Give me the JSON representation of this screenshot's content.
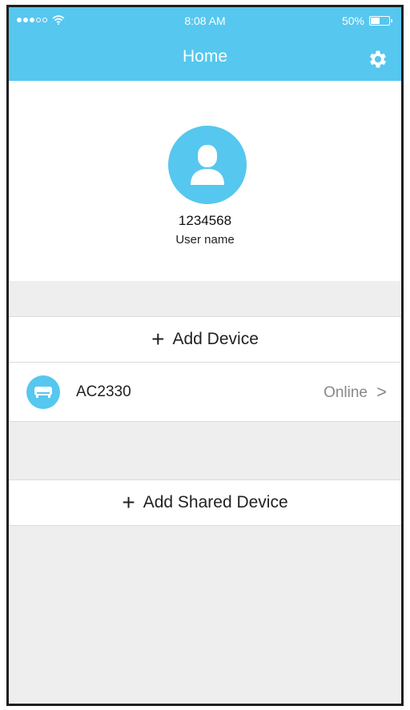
{
  "status_bar": {
    "time": "8:08 AM",
    "battery": "50%",
    "battery_level": 0.5
  },
  "header": {
    "title": "Home",
    "settings_icon": "gear-icon"
  },
  "profile": {
    "user_id": "1234568",
    "user_name": "User name",
    "avatar_icon": "user-icon"
  },
  "actions": {
    "add_device_label": "Add Device",
    "add_shared_device_label": "Add Shared Device",
    "plus_glyph": "+"
  },
  "devices": [
    {
      "name": "AC2330",
      "status": "Online",
      "icon": "air-conditioner-icon",
      "chevron": ">"
    }
  ],
  "colors": {
    "accent": "#56c7ee",
    "background": "#eeeeee",
    "status_text": "#888888"
  }
}
